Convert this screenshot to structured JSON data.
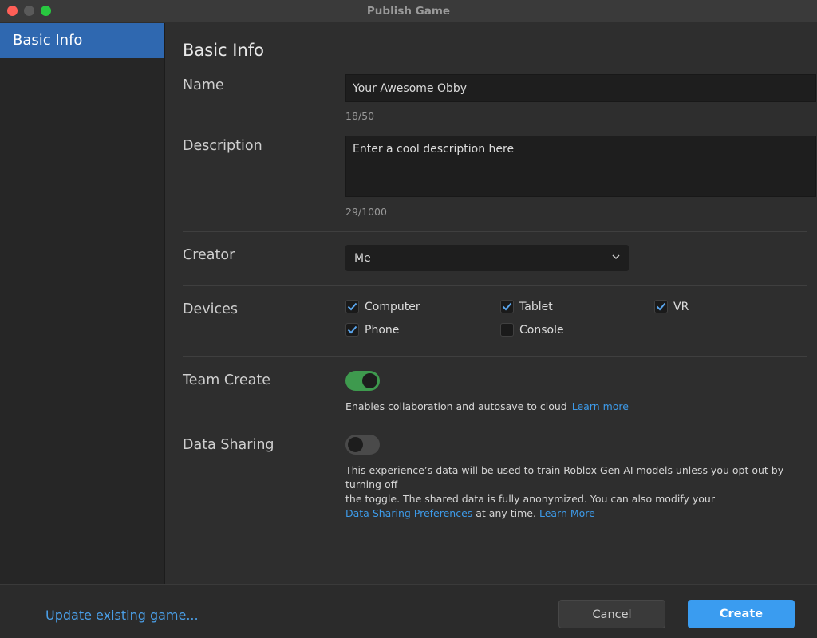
{
  "window": {
    "title": "Publish Game"
  },
  "sidebar": {
    "items": [
      {
        "label": "Basic Info"
      }
    ]
  },
  "main": {
    "heading": "Basic Info",
    "name": {
      "label": "Name",
      "value": "Your Awesome Obby",
      "counter": "18/50"
    },
    "description": {
      "label": "Description",
      "placeholder": "Enter a cool description here",
      "counter": "29/1000"
    },
    "creator": {
      "label": "Creator",
      "value": "Me"
    },
    "devices": {
      "label": "Devices",
      "options": [
        {
          "label": "Computer",
          "checked": true
        },
        {
          "label": "Tablet",
          "checked": true
        },
        {
          "label": "VR",
          "checked": true
        },
        {
          "label": "Phone",
          "checked": true
        },
        {
          "label": "Console",
          "checked": false
        }
      ]
    },
    "team_create": {
      "label": "Team Create",
      "enabled": true,
      "hint": "Enables collaboration and autosave to cloud",
      "learn_more": "Learn more"
    },
    "data_sharing": {
      "label": "Data Sharing",
      "enabled": false,
      "line1": "This experience’s data will be used to train Roblox Gen AI models unless you opt out by turning off",
      "line2": "the toggle. The shared data is fully anonymized. You can also modify your",
      "preferences_link": "Data Sharing Preferences",
      "line3_rest": " at any time. ",
      "learn_more": "Learn More"
    }
  },
  "footer": {
    "update_link": "Update existing game...",
    "cancel_label": "Cancel",
    "create_label": "Create"
  },
  "colors": {
    "accent": "#3a9cf0",
    "sidebar_selected": "#2f68b0",
    "toggle_on": "#3e9a4e",
    "link": "#3d9ae8"
  }
}
